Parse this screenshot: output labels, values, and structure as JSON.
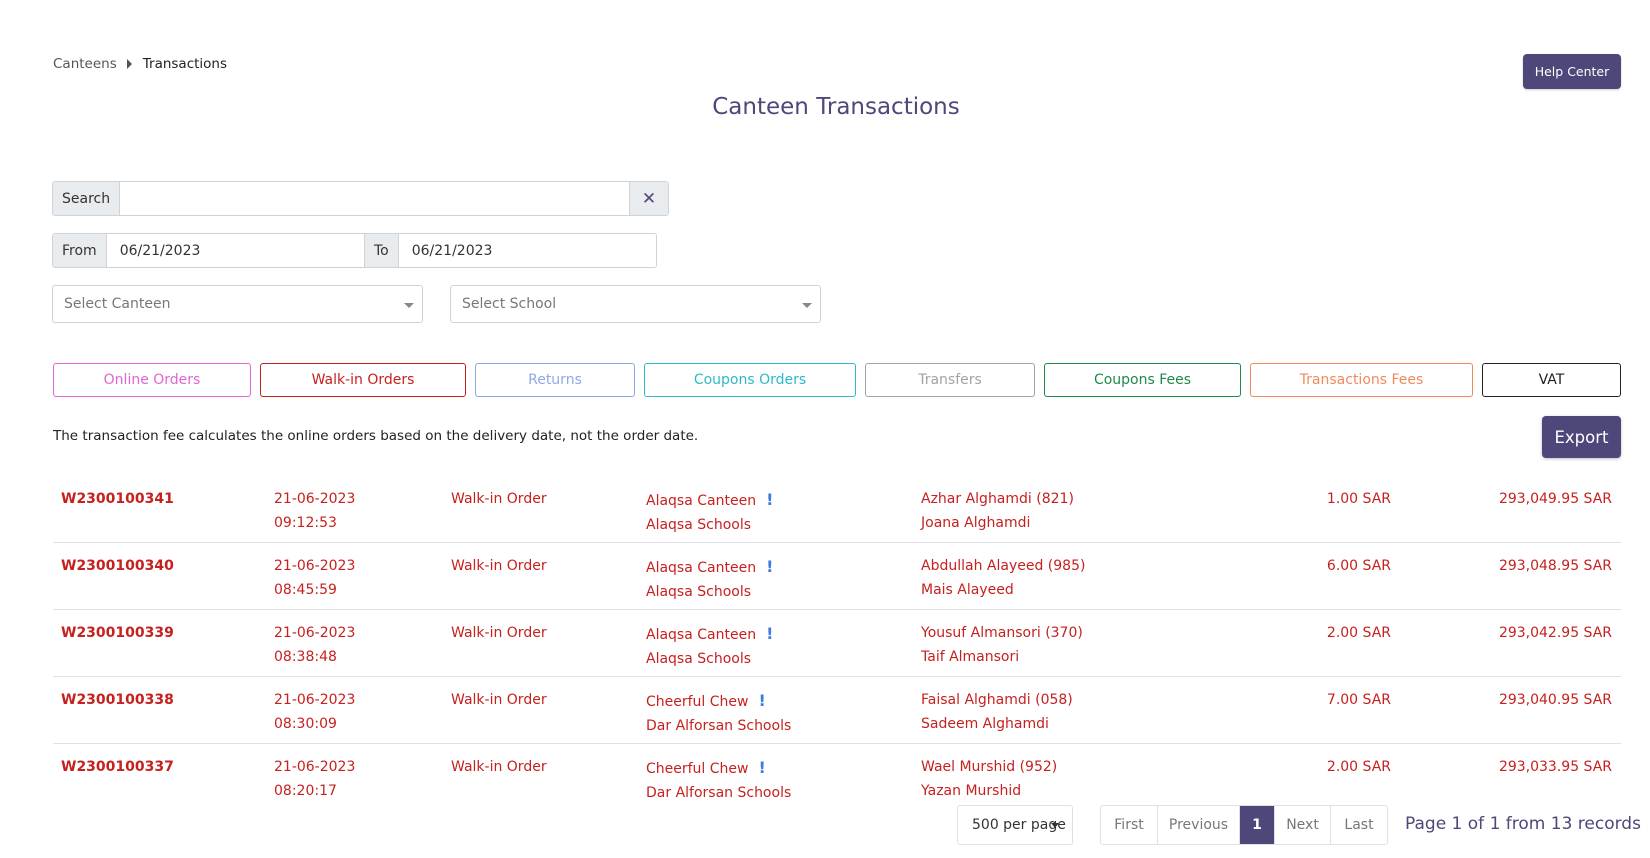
{
  "breadcrumb": {
    "root": "Canteens",
    "current": "Transactions"
  },
  "help_center_label": "Help Center",
  "title": "Canteen Transactions",
  "search": {
    "label": "Search",
    "value": "",
    "clear_icon": "close-icon"
  },
  "dates": {
    "from_label": "From",
    "from_value": "06/21/2023",
    "to_label": "To",
    "to_value": "06/21/2023"
  },
  "selects": {
    "canteen_placeholder": "Select Canteen",
    "school_placeholder": "Select School"
  },
  "tabs": [
    {
      "label": "Online Orders",
      "color": "#e066d3"
    },
    {
      "label": "Walk-in Orders",
      "color": "#c6211f"
    },
    {
      "label": "Returns",
      "color": "#8ea9e8"
    },
    {
      "label": "Coupons Orders",
      "color": "#2cbac8"
    },
    {
      "label": "Transfers",
      "color": "#a3a3a3"
    },
    {
      "label": "Coupons Fees",
      "color": "#1e8a4c"
    },
    {
      "label": "Transactions Fees",
      "color": "#f08a5d"
    },
    {
      "label": "VAT",
      "color": "#222222"
    }
  ],
  "note": "The transaction fee calculates the online orders based on the delivery date, not the order date.",
  "export_label": "Export",
  "transactions": [
    {
      "id": "W2300100341",
      "date": "21-06-2023",
      "time": "09:12:53",
      "type": "Walk-in Order",
      "canteen": "Alaqsa Canteen",
      "school": "Alaqsa Schools",
      "student": "Azhar Alghamdi (821)",
      "parent": "Joana Alghamdi",
      "amount": "1.00 SAR",
      "balance": "293,049.95 SAR"
    },
    {
      "id": "W2300100340",
      "date": "21-06-2023",
      "time": "08:45:59",
      "type": "Walk-in Order",
      "canteen": "Alaqsa Canteen",
      "school": "Alaqsa Schools",
      "student": "Abdullah Alayeed (985)",
      "parent": "Mais Alayeed",
      "amount": "6.00 SAR",
      "balance": "293,048.95 SAR"
    },
    {
      "id": "W2300100339",
      "date": "21-06-2023",
      "time": "08:38:48",
      "type": "Walk-in Order",
      "canteen": "Alaqsa Canteen",
      "school": "Alaqsa Schools",
      "student": "Yousuf Almansori (370)",
      "parent": "Taif Almansori",
      "amount": "2.00 SAR",
      "balance": "293,042.95 SAR"
    },
    {
      "id": "W2300100338",
      "date": "21-06-2023",
      "time": "08:30:09",
      "type": "Walk-in Order",
      "canteen": "Cheerful Chew",
      "school": "Dar Alforsan Schools",
      "student": "Faisal Alghamdi (058)",
      "parent": "Sadeem Alghamdi",
      "amount": "7.00 SAR",
      "balance": "293,040.95 SAR"
    },
    {
      "id": "W2300100337",
      "date": "21-06-2023",
      "time": "08:20:17",
      "type": "Walk-in Order",
      "canteen": "Cheerful Chew",
      "school": "Dar Alforsan Schools",
      "student": "Wael Murshid (952)",
      "parent": "Yazan Murshid",
      "amount": "2.00 SAR",
      "balance": "293,033.95 SAR"
    }
  ],
  "pagination": {
    "per_page": "500 per page",
    "first": "First",
    "previous": "Previous",
    "current": "1",
    "next": "Next",
    "last": "Last",
    "info": "Page 1 of 1 from 13 records"
  },
  "colors": {
    "primary": "#4e4779",
    "row_text": "#c6211f",
    "info_icon": "#3a7de0"
  }
}
